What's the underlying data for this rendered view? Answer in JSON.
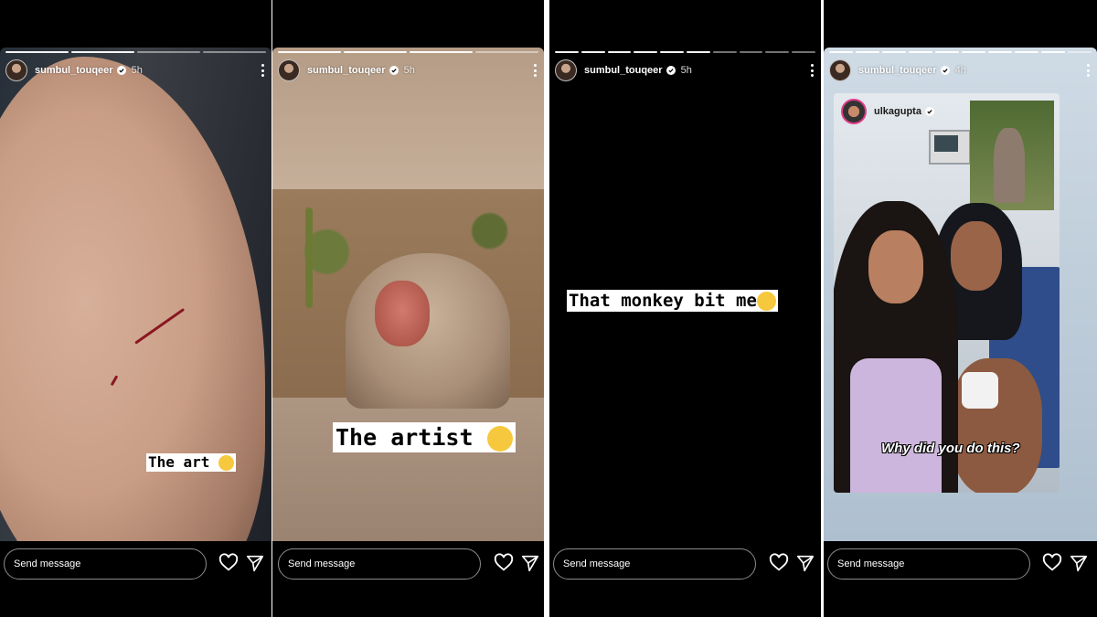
{
  "stories": [
    {
      "username": "sumbul_touqeer",
      "time": "5h",
      "sticker_text": "The art",
      "message_placeholder": "Send message"
    },
    {
      "username": "sumbul_touqeer",
      "time": "5h",
      "sticker_text": "The artist",
      "message_placeholder": "Send message"
    },
    {
      "username": "sumbul_touqeer",
      "time": "5h",
      "sticker_text": "That monkey bit me",
      "message_placeholder": "Send message"
    },
    {
      "username": "sumbul_touqeer",
      "time": "4h",
      "repost_username": "ulkagupta",
      "caption": "Why did you do this?",
      "message_placeholder": "Send message"
    }
  ],
  "icons": {
    "verified": "verified-badge-icon",
    "more": "more-options-icon",
    "like": "heart-icon",
    "share": "send-icon"
  },
  "colors": {
    "background": "#000000",
    "text": "#ffffff",
    "verified_badge": "#ffffff"
  }
}
